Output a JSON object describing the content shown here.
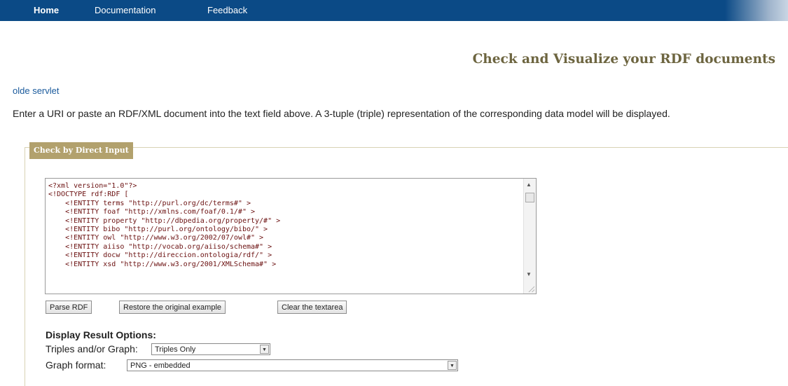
{
  "nav": {
    "home": "Home",
    "documentation": "Documentation",
    "feedback": "Feedback"
  },
  "page": {
    "heading": "Check and Visualize your RDF documents",
    "servlet_link": "olde servlet",
    "description": "Enter a URI or paste an RDF/XML document into the text field above. A 3-tuple (triple) representation of the corresponding data model will be displayed."
  },
  "form": {
    "legend": "Check by Direct Input",
    "textarea_value": "<?xml version=\"1.0\"?>\n<!DOCTYPE rdf:RDF [\n    <!ENTITY terms \"http://purl.org/dc/terms#\" >\n    <!ENTITY foaf \"http://xmlns.com/foaf/0.1/#\" >\n    <!ENTITY property \"http://dbpedia.org/property/#\" >\n    <!ENTITY bibo \"http://purl.org/ontology/bibo/\" >\n    <!ENTITY owl \"http://www.w3.org/2002/07/owl#\" >\n    <!ENTITY aiiso \"http://vocab.org/aiiso/schema#\" >\n    <!ENTITY docw \"http://direccion.ontologia/rdf/\" >\n    <!ENTITY xsd \"http://www.w3.org/2001/XMLSchema#\" >",
    "buttons": {
      "parse": "Parse RDF",
      "restore": "Restore the original example",
      "clear": "Clear the textarea"
    }
  },
  "options": {
    "title": "Display Result Options:",
    "triples_label": "Triples and/or Graph:",
    "triples_value": "Triples Only",
    "graph_label": "Graph format:",
    "graph_value": "PNG - embedded"
  }
}
